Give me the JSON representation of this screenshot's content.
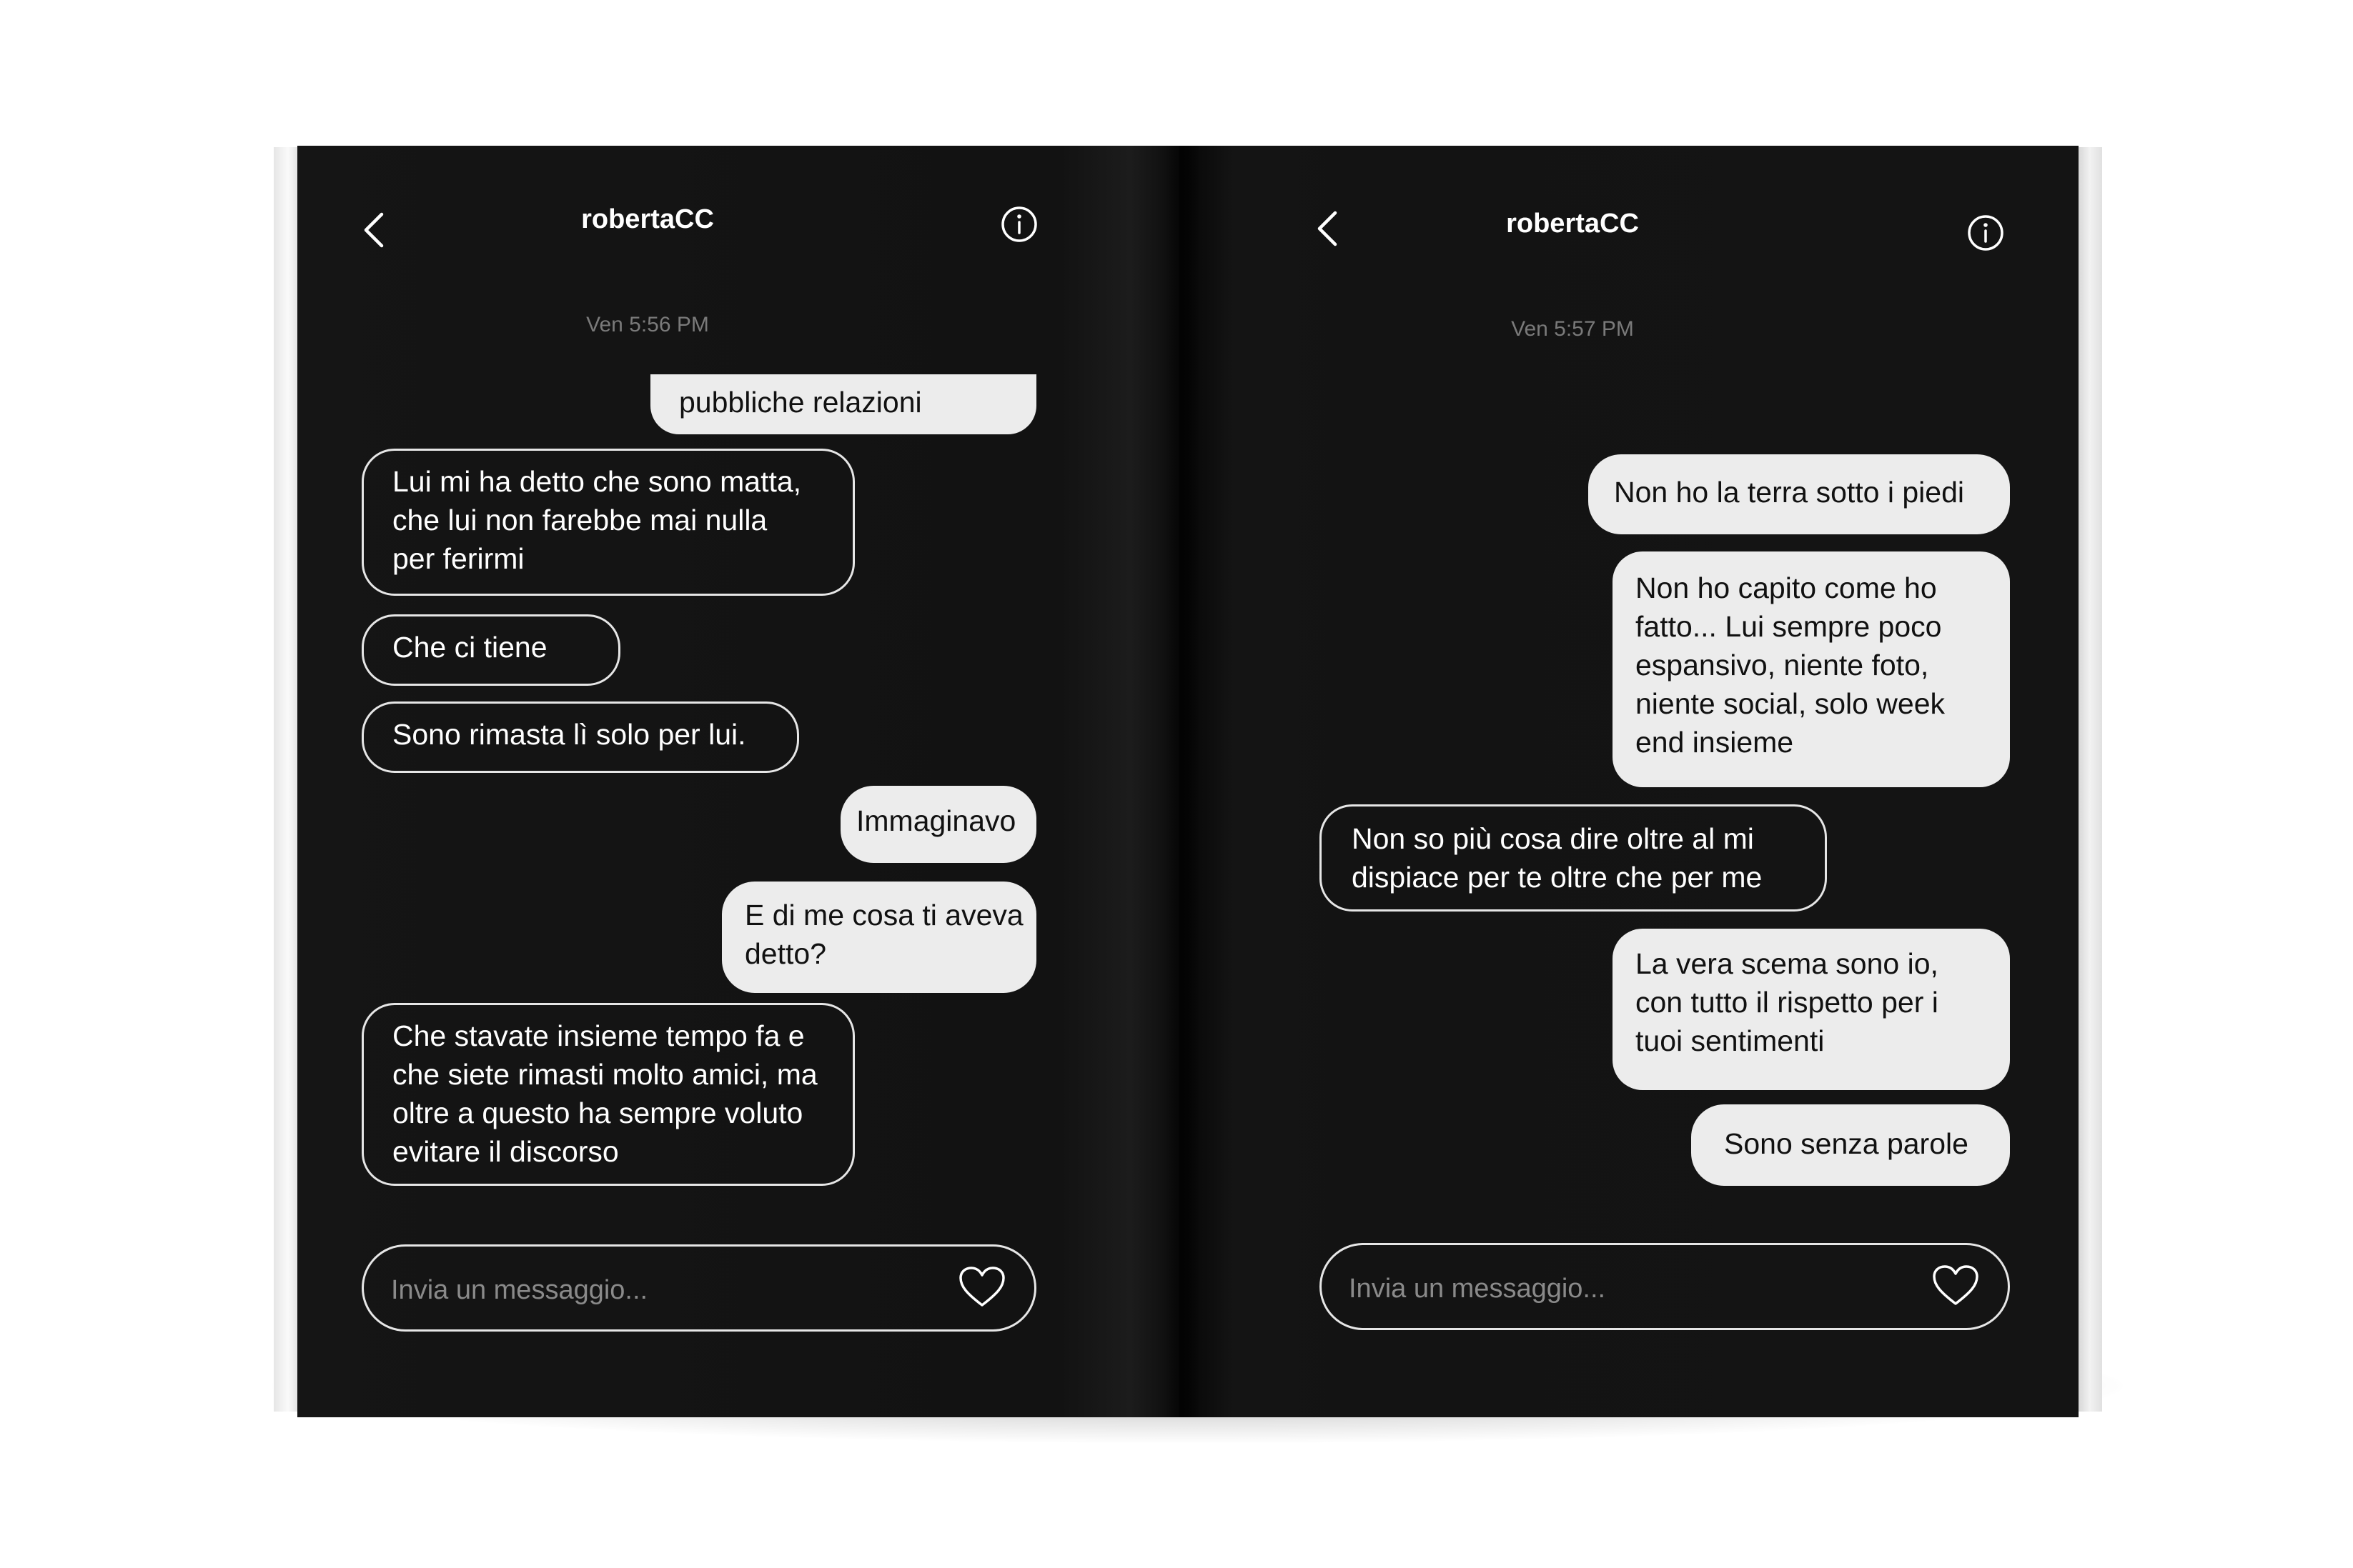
{
  "colors": {
    "page_background": "#131313",
    "outgoing_bubble": "#ececec",
    "bubble_outline": "#e6e6e6",
    "timestamp_text": "#7a7a7a"
  },
  "left_page": {
    "header": {
      "back_icon": "chevron-left-icon",
      "title": "robertaCC",
      "info_icon": "info-circle-icon"
    },
    "timestamp": "Ven 5:56 PM",
    "messages": [
      {
        "side": "outgoing",
        "lines": [
          "pubbliche relazioni"
        ]
      },
      {
        "side": "incoming",
        "lines": [
          "Lui mi ha detto che sono matta,",
          "che lui non farebbe mai nulla",
          "per ferirmi"
        ]
      },
      {
        "side": "incoming",
        "lines": [
          "Che ci tiene"
        ]
      },
      {
        "side": "incoming",
        "lines": [
          "Sono rimasta lì solo per lui."
        ]
      },
      {
        "side": "outgoing",
        "lines": [
          "Immaginavo"
        ]
      },
      {
        "side": "outgoing",
        "lines": [
          "E di me cosa ti aveva",
          "detto?"
        ]
      },
      {
        "side": "incoming",
        "lines": [
          "Che stavate insieme tempo fa e",
          "che siete rimasti molto amici, ma",
          "oltre a questo ha sempre voluto",
          "evitare il discorso"
        ]
      }
    ],
    "composer": {
      "placeholder": "Invia un messaggio...",
      "heart_icon": "heart-icon"
    }
  },
  "right_page": {
    "header": {
      "back_icon": "chevron-left-icon",
      "title": "robertaCC",
      "info_icon": "info-circle-icon"
    },
    "timestamp": "Ven 5:57 PM",
    "messages": [
      {
        "side": "outgoing",
        "lines": [
          "Non ho la terra sotto i piedi"
        ]
      },
      {
        "side": "outgoing",
        "lines": [
          "Non ho capito come ho",
          "fatto... Lui sempre poco",
          "espansivo, niente foto,",
          "niente social, solo week",
          "end insieme"
        ]
      },
      {
        "side": "incoming",
        "lines": [
          "Non so più cosa dire oltre al mi",
          "dispiace per te oltre che per me"
        ]
      },
      {
        "side": "outgoing",
        "lines": [
          "La vera scema sono io,",
          "con tutto il rispetto per i",
          "tuoi sentimenti"
        ]
      },
      {
        "side": "outgoing",
        "lines": [
          "Sono senza parole"
        ]
      }
    ],
    "composer": {
      "placeholder": "Invia un messaggio...",
      "heart_icon": "heart-icon"
    }
  }
}
